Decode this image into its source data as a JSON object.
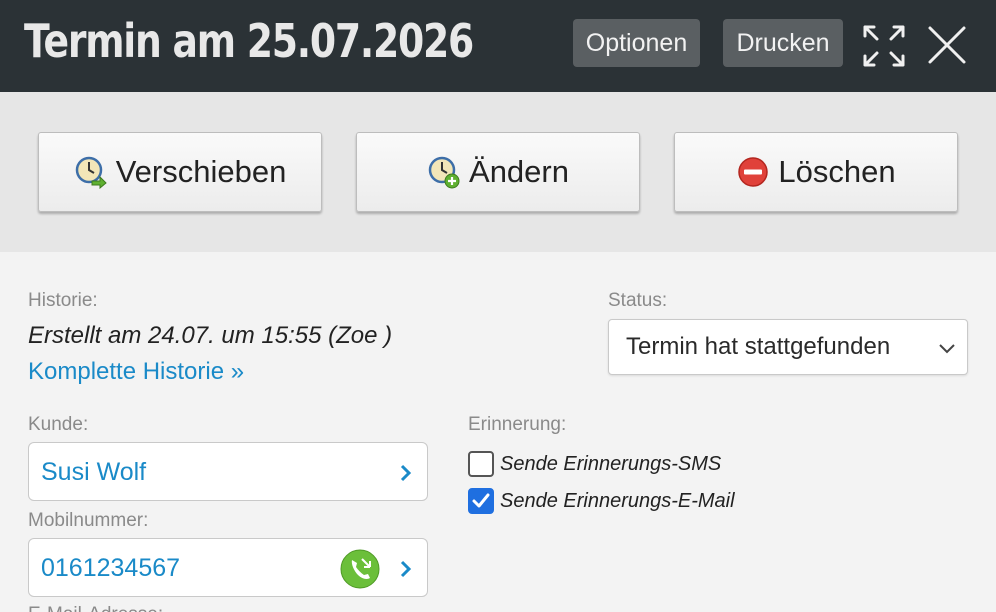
{
  "header": {
    "title": "Termin am 25.07.2026",
    "options_label": "Optionen",
    "print_label": "Drucken",
    "expand_icon": "expand-icon",
    "close_icon": "close-icon"
  },
  "actions": [
    {
      "label": "Verschieben",
      "icon": "clock-arrow-icon"
    },
    {
      "label": "Ändern",
      "icon": "clock-plus-icon"
    },
    {
      "label": "Löschen",
      "icon": "delete-icon"
    }
  ],
  "history": {
    "label": "Historie:",
    "created": "Erstellt am 24.07. um 15:55 (Zoe )",
    "link": "Komplette Historie »"
  },
  "status": {
    "label": "Status:",
    "selected": "Termin hat stattgefunden"
  },
  "customer": {
    "label": "Kunde:",
    "name": "Susi Wolf"
  },
  "mobile": {
    "label": "Mobilnummer:",
    "number": "0161234567"
  },
  "email": {
    "label": "E-Mail-Adresse:"
  },
  "reminder": {
    "label": "Erinnerung:",
    "options": [
      {
        "label": "Sende Erinnerungs-SMS",
        "checked": false
      },
      {
        "label": "Sende Erinnerungs-E-Mail",
        "checked": true
      }
    ]
  },
  "colors": {
    "header_bg": "#2b3236",
    "link": "#1a8ac8",
    "checkbox": "#1f6fe0",
    "delete": "#e0413a",
    "phone": "#6bbf3a"
  }
}
